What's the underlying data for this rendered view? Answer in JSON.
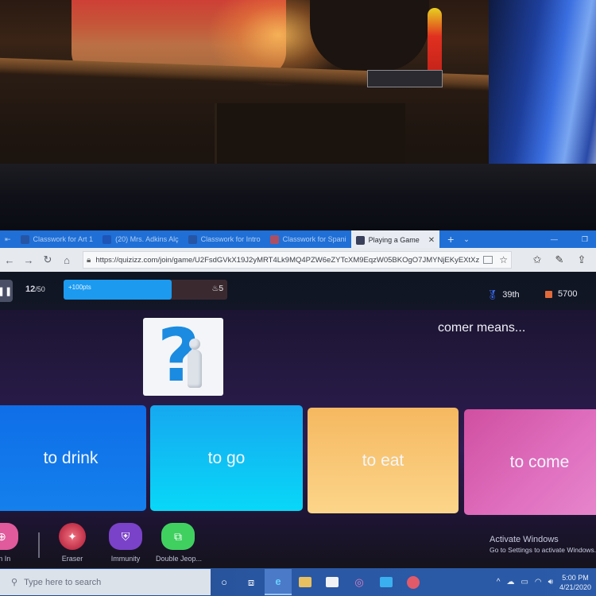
{
  "browser": {
    "tabs": [
      {
        "label": "Classwork for Art 1",
        "icon": "google-classroom-icon",
        "color": "#2a4f9a"
      },
      {
        "label": "(20) Mrs. Adkins Alç",
        "icon": "facebook-icon",
        "color": "#1e4fb0"
      },
      {
        "label": "Classwork for Intro",
        "icon": "google-classroom-icon",
        "color": "#2a4f9a"
      },
      {
        "label": "Classwork for Spani",
        "icon": "google-classroom-icon",
        "color": "#d04848"
      },
      {
        "label": "Playing a Game",
        "icon": "quizizz-icon",
        "color": "#3a3f5a",
        "active": true
      }
    ],
    "new_tab_icon": "+",
    "tab_menu_icon": "⌄",
    "minimize_icon": "—",
    "restore_icon": "❐",
    "url": "https://quizizz.com/join/game/U2FsdGVkX19J2yMRT4Lk9MQ4PZW6eZYTcXM9EqzW05BKOgO7JMYNjEKyEXtXz"
  },
  "game": {
    "question_counter": {
      "current": "12",
      "total": "/50"
    },
    "progress": {
      "label": "+100pts",
      "fill_fraction": 0.66
    },
    "streak": "5",
    "rank": "39th",
    "score": "5700",
    "question_text": "comer means...",
    "options": [
      {
        "label": "to drink",
        "color": "#0f6ee8"
      },
      {
        "label": "to go",
        "color": "#10c0f4"
      },
      {
        "label": "to eat",
        "color": "#f8c470"
      },
      {
        "label": "to come",
        "color": "#d85cae"
      }
    ],
    "powerups": [
      {
        "label": "om In",
        "icon": "zoom-in-icon"
      },
      {
        "label": "Eraser",
        "icon": "eraser-icon"
      },
      {
        "label": "Immunity",
        "icon": "shield-icon"
      },
      {
        "label": "Double Jeop...",
        "icon": "double-jeopardy-icon"
      }
    ]
  },
  "windows": {
    "activate_title": "Activate Windows",
    "activate_sub": "Go to Settings to activate Windows.",
    "search_placeholder": "Type here to search",
    "clock_time": "5:00 PM",
    "clock_date": "4/21/2020"
  }
}
